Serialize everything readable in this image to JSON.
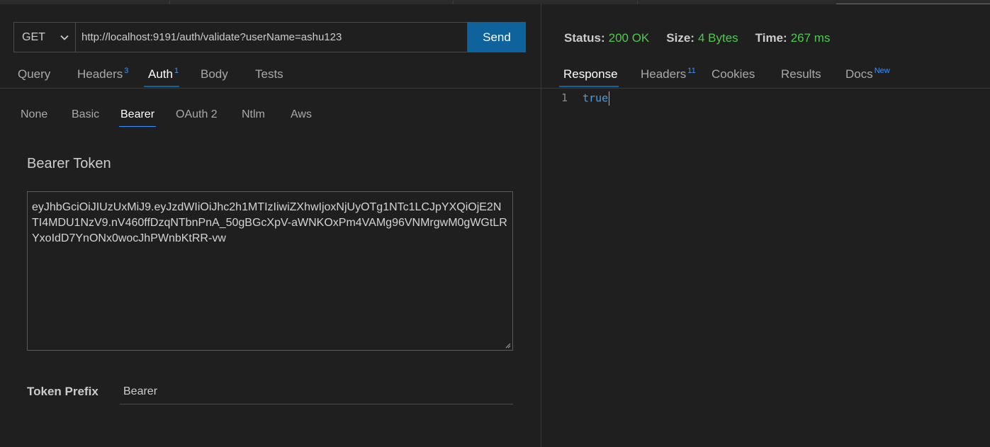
{
  "request": {
    "method": "GET",
    "url": "http://localhost:9191/auth/validate?userName=ashu123",
    "send_label": "Send"
  },
  "request_tabs": [
    {
      "label": "Query",
      "badge": ""
    },
    {
      "label": "Headers",
      "badge": "3"
    },
    {
      "label": "Auth",
      "badge": "1"
    },
    {
      "label": "Body",
      "badge": ""
    },
    {
      "label": "Tests",
      "badge": ""
    }
  ],
  "auth_tabs": [
    "None",
    "Basic",
    "Bearer",
    "OAuth 2",
    "Ntlm",
    "Aws"
  ],
  "bearer": {
    "title": "Bearer Token",
    "token": "eyJhbGciOiJIUzUxMiJ9.eyJzdWIiOiJhc2h1MTIzIiwiZXhwIjoxNjUyOTg1NTc1LCJpYXQiOjE2NTI4MDU1NzV9.nV460ffDzqNTbnPnA_50gBGcXpV-aWNKOxPm4VAMg96VNMrgwM0gWGtLRYxoIdD7YnONx0wocJhPWnbKtRR-vw",
    "prefix_label": "Token Prefix",
    "prefix_value": "Bearer"
  },
  "status": {
    "status_label": "Status:",
    "status_value": "200 OK",
    "size_label": "Size:",
    "size_value": "4 Bytes",
    "time_label": "Time:",
    "time_value": "267 ms"
  },
  "response_tabs": [
    {
      "label": "Response",
      "badge": ""
    },
    {
      "label": "Headers",
      "badge": "11"
    },
    {
      "label": "Cookies",
      "badge": ""
    },
    {
      "label": "Results",
      "badge": ""
    },
    {
      "label": "Docs",
      "badge": "New"
    }
  ],
  "response_body": {
    "line_number": "1",
    "content": "true"
  },
  "colors": {
    "accent": "#0e639c",
    "success": "#4ec94e",
    "badge": "#3794ff",
    "keyword": "#569cd6"
  }
}
